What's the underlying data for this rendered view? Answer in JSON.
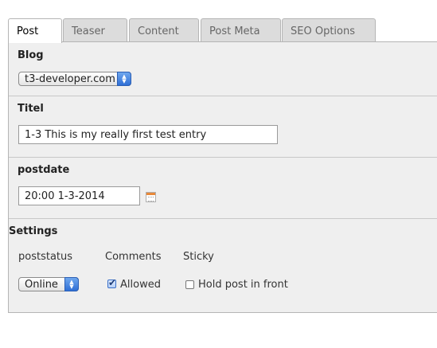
{
  "tabs": [
    {
      "label": "Post",
      "active": true
    },
    {
      "label": "Teaser",
      "active": false
    },
    {
      "label": "Content",
      "active": false
    },
    {
      "label": "Post Meta",
      "active": false
    },
    {
      "label": "SEO Options",
      "active": false
    }
  ],
  "blog": {
    "title": "Blog",
    "selected": "t3-developer.com"
  },
  "titel": {
    "title": "Titel",
    "value": "1-3 This is my really first test entry"
  },
  "postdate": {
    "title": "postdate",
    "value": "20:00 1-3-2014",
    "icon": "calendar-icon"
  },
  "settings": {
    "title": "Settings",
    "poststatus": {
      "label": "poststatus",
      "selected": "Online"
    },
    "comments": {
      "label": "Comments",
      "checkbox_label": "Allowed",
      "checked": true
    },
    "sticky": {
      "label": "Sticky",
      "checkbox_label": "Hold post in front",
      "checked": false
    }
  },
  "colors": {
    "panel_bg": "#efefef",
    "select_arrow": "#2f6fd6",
    "calendar_accent": "#e8893a"
  }
}
